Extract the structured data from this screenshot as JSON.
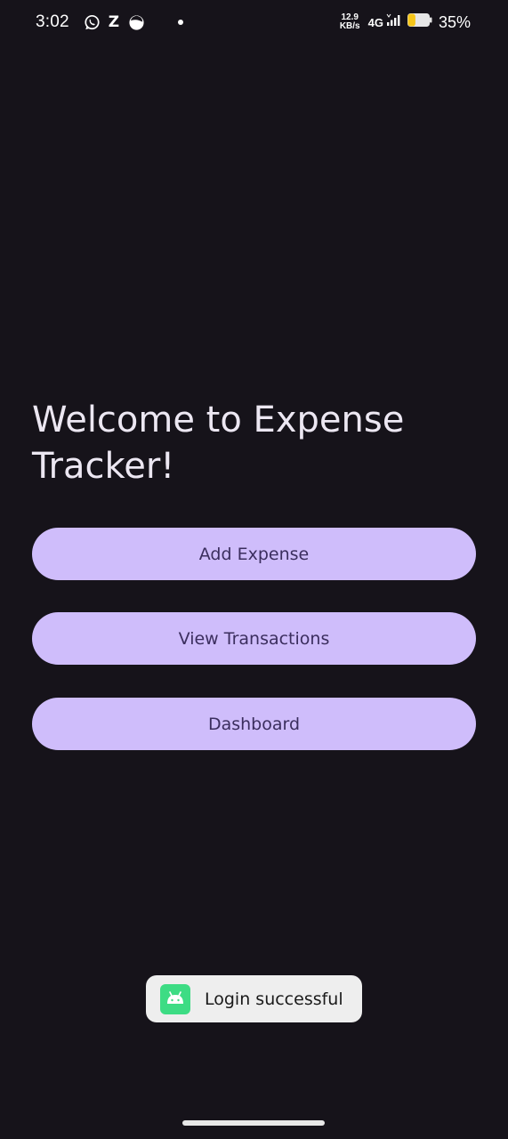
{
  "status_bar": {
    "time": "3:02",
    "notification_icons": [
      "whatsapp-icon",
      "z-icon",
      "halfmoon-icon",
      "dot-icon"
    ],
    "z_label": "Z",
    "net_speed_value": "12.9",
    "net_speed_unit": "KB/s",
    "network_type": "4G",
    "battery_percent": "35%",
    "battery_level": 0.35
  },
  "main": {
    "title": "Welcome to Expense Tracker!",
    "buttons": {
      "add_expense": "Add Expense",
      "view_transactions": "View Transactions",
      "dashboard": "Dashboard"
    }
  },
  "toast": {
    "icon": "android-app-icon",
    "message": "Login successful"
  },
  "colors": {
    "background": "#16131a",
    "button_fill": "#cfbdfb",
    "button_text": "#3b2e5e",
    "title_text": "#ece7f2",
    "toast_bg": "#eeeeee",
    "battery_fill": "#f5c518",
    "android_green": "#3ddc84"
  }
}
